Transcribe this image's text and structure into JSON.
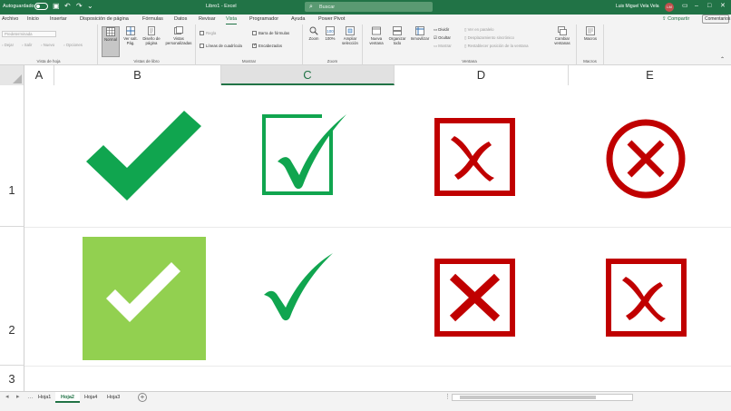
{
  "titlebar": {
    "autosave_label": "Autoguardado",
    "document_title": "Libro1 - Excel",
    "search_placeholder": "Buscar",
    "user_name": "Luis Miguel Vela Vela",
    "user_initials": "LM"
  },
  "ribbon_tabs": {
    "items": [
      "Archivo",
      "Inicio",
      "Insertar",
      "Disposición de página",
      "Fórmulas",
      "Datos",
      "Revisar",
      "Vista",
      "Programador",
      "Ayuda",
      "Power Pivot"
    ],
    "active": "Vista",
    "share_label": "Compartir",
    "comments_label": "Comentarios"
  },
  "ribbon": {
    "sheet_view": {
      "label": "Vista de hoja",
      "dropdown": "Predeterminada",
      "keep": "Dejar",
      "exit": "Salir",
      "new": "Nuevo",
      "options": "Opciones"
    },
    "workbook_views": {
      "label": "Vistas de libro",
      "normal": "Normal",
      "page_break": "Ver salt. Pág.",
      "page_layout": "Diseño de página",
      "custom": "Vistas personalizadas"
    },
    "show": {
      "label": "Mostrar",
      "ruler": "Regla",
      "formula_bar": "Barra de fórmulas",
      "gridlines": "Líneas de cuadrícula",
      "headings": "Encabezados"
    },
    "zoom": {
      "label": "Zoom",
      "zoom": "Zoom",
      "hundred": "100%",
      "fit": "Ampliar selección"
    },
    "window": {
      "label": "Ventana",
      "new_window": "Nueva ventana",
      "arrange_all": "Organizar todo",
      "freeze": "Inmovilizar",
      "split": "Dividir",
      "hide": "Ocultar",
      "unhide": "Mostrar",
      "side_by_side": "Ver en paralelo",
      "sync_scroll": "Desplazamiento sincrónico",
      "reset_position": "Restablecer posición de la ventana",
      "switch": "Cambiar ventanas"
    },
    "macros": {
      "label": "Macros",
      "macros": "Macros"
    }
  },
  "columns": [
    "A",
    "B",
    "C",
    "D",
    "E"
  ],
  "selected_column": "C",
  "rows": [
    "1",
    "2",
    "3"
  ],
  "sheets": [
    "Hoja1",
    "Hoja2",
    "Hoja4",
    "Hoja3"
  ],
  "active_sheet": "Hoja2",
  "colors": {
    "excel_green": "#217346",
    "check_green": "#16a34a",
    "light_green": "#92d050",
    "cross_red": "#c00000"
  }
}
